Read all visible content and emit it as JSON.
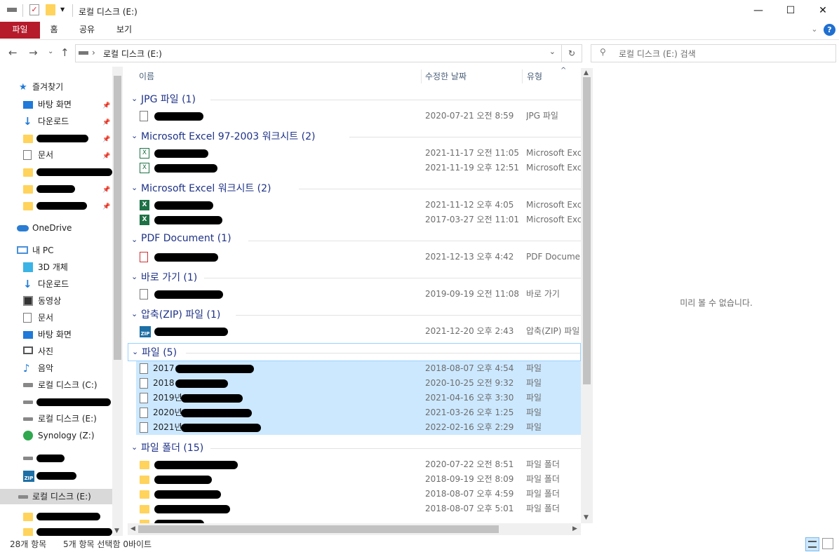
{
  "window": {
    "title": "로컬 디스크 (E:)",
    "controls": {
      "minimize": "—",
      "maximize": "☐",
      "close": "✕"
    }
  },
  "ribbon": {
    "tabs": [
      "파일",
      "홈",
      "공유",
      "보기"
    ],
    "expand_icon": "chevron-down-icon",
    "help": "?"
  },
  "address": {
    "path_sep": "›",
    "location": "로컬 디스크 (E:)",
    "search_placeholder": "로컬 디스크 (E:) 검색"
  },
  "nav": {
    "quick_access": "즐겨찾기",
    "quick_items": [
      {
        "label": "바탕 화면",
        "icon": "desktop-icon",
        "pinned": true
      },
      {
        "label": "다운로드",
        "icon": "download-icon",
        "pinned": true
      },
      {
        "label": "",
        "icon": "folder-icon",
        "pinned": true,
        "redacted": true
      },
      {
        "label": "문서",
        "icon": "document-icon",
        "pinned": true
      },
      {
        "label": "",
        "icon": "folder-icon",
        "pinned": false,
        "redacted": true
      },
      {
        "label": "",
        "icon": "folder-icon",
        "pinned": true,
        "redacted": true
      },
      {
        "label": "",
        "icon": "folder-icon",
        "pinned": true,
        "redacted": true
      }
    ],
    "onedrive": "OneDrive",
    "this_pc": "내 PC",
    "pc_items": [
      {
        "label": "3D 개체",
        "icon": "cube-icon"
      },
      {
        "label": "다운로드",
        "icon": "download-icon"
      },
      {
        "label": "동영상",
        "icon": "video-icon"
      },
      {
        "label": "문서",
        "icon": "document-icon"
      },
      {
        "label": "바탕 화면",
        "icon": "desktop-icon"
      },
      {
        "label": "사진",
        "icon": "picture-icon"
      },
      {
        "label": "음악",
        "icon": "music-icon"
      },
      {
        "label": "로컬 디스크 (C:)",
        "icon": "windows-drive-icon"
      },
      {
        "label": "",
        "icon": "drive-icon",
        "redacted": true
      },
      {
        "label": "로컬 디스크 (E:)",
        "icon": "drive-icon"
      },
      {
        "label": "Synology (Z:)",
        "icon": "network-drive-icon"
      }
    ],
    "bottom_items": [
      {
        "label": "",
        "icon": "drive-icon",
        "redacted": true
      },
      {
        "label": "",
        "icon": "zip-icon",
        "redacted": true
      },
      {
        "label": "로컬 디스크 (E:)",
        "icon": "drive-icon",
        "selected": true
      },
      {
        "label": "",
        "icon": "folder-icon",
        "redacted": true
      },
      {
        "label": "",
        "icon": "folder-icon",
        "redacted": true
      }
    ]
  },
  "columns": {
    "name": "이름",
    "modified": "수정한 날짜",
    "type": "유형"
  },
  "groups": [
    {
      "label": "JPG 파일 (1)",
      "rows": [
        {
          "name": "",
          "date": "2020-07-21 오전 8:59",
          "type": "JPG 파일",
          "icon": "image-file-icon"
        }
      ]
    },
    {
      "label": "Microsoft Excel 97-2003 워크시트 (2)",
      "rows": [
        {
          "name": "",
          "date": "2021-11-17 오전 11:05",
          "type": "Microsoft Exce",
          "icon": "excel-old-icon"
        },
        {
          "name": "",
          "date": "2021-11-19 오후 12:51",
          "type": "Microsoft Exce",
          "icon": "excel-old-icon"
        }
      ]
    },
    {
      "label": "Microsoft Excel 워크시트 (2)",
      "rows": [
        {
          "name": "",
          "date": "2021-11-12 오후 4:05",
          "type": "Microsoft Exce",
          "icon": "excel-icon"
        },
        {
          "name": "",
          "date": "2017-03-27 오전 11:01",
          "type": "Microsoft Exce",
          "icon": "excel-icon"
        }
      ]
    },
    {
      "label": "PDF Document (1)",
      "rows": [
        {
          "name": "",
          "date": "2021-12-13 오후 4:42",
          "type": "PDF Documen",
          "icon": "pdf-icon"
        }
      ]
    },
    {
      "label": "바로 가기 (1)",
      "rows": [
        {
          "name": "",
          "date": "2019-09-19 오전 11:08",
          "type": "바로 가기",
          "icon": "shortcut-icon"
        }
      ]
    },
    {
      "label": "압축(ZIP) 파일 (1)",
      "rows": [
        {
          "name": "",
          "date": "2021-12-20 오후 2:43",
          "type": "압축(ZIP) 파일",
          "icon": "zip-icon"
        }
      ]
    },
    {
      "label": "파일 (5)",
      "focused": true,
      "rows": [
        {
          "name": "2017",
          "date": "2018-08-07 오후 4:54",
          "type": "파일",
          "icon": "file-icon",
          "selected": true
        },
        {
          "name": "2018",
          "date": "2020-10-25 오전 9:32",
          "type": "파일",
          "icon": "file-icon",
          "selected": true
        },
        {
          "name": "2019년",
          "date": "2021-04-16 오후 3:30",
          "type": "파일",
          "icon": "file-icon",
          "selected": true
        },
        {
          "name": "2020년",
          "date": "2021-03-26 오후 1:25",
          "type": "파일",
          "icon": "file-icon",
          "selected": true
        },
        {
          "name": "2021년",
          "date": "2022-02-16 오후 2:29",
          "type": "파일",
          "icon": "file-icon",
          "selected": true
        }
      ]
    },
    {
      "label": "파일 폴더 (15)",
      "rows": [
        {
          "name": "",
          "date": "2020-07-22 오전 8:51",
          "type": "파일 폴더",
          "icon": "folder-icon"
        },
        {
          "name": "",
          "date": "2018-09-19 오전 8:09",
          "type": "파일 폴더",
          "icon": "folder-icon"
        },
        {
          "name": "",
          "date": "2018-08-07 오후 4:59",
          "type": "파일 폴더",
          "icon": "folder-icon"
        },
        {
          "name": "",
          "date": "2018-08-07 오후 5:01",
          "type": "파일 폴더",
          "icon": "folder-icon"
        },
        {
          "name": "",
          "date": "",
          "type": "",
          "icon": "folder-icon"
        }
      ]
    }
  ],
  "preview": {
    "message": "미리 볼 수 없습니다."
  },
  "status": {
    "item_count": "28개 항목",
    "selection": "5개 항목 선택함 0바이트"
  }
}
